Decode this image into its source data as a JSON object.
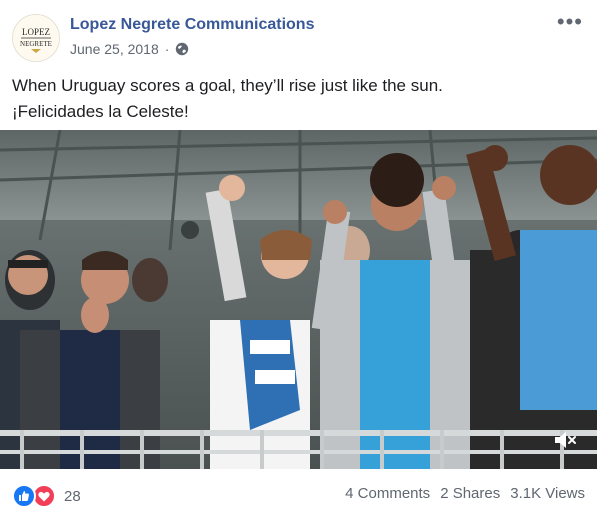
{
  "post": {
    "page_name": "Lopez Negrete Communications",
    "date": "June 25, 2018",
    "separator": "·",
    "privacy_icon": "globe-icon",
    "more_icon": "more-options-icon",
    "avatar_logo_text": "LOPEZ NEGRETE",
    "text_line_1": "When Uruguay scores a goal, they’ll rise just like the sun.",
    "text_line_2": "¡Felicidades la Celeste!"
  },
  "video": {
    "description_icon": "mute-icon"
  },
  "footer": {
    "reaction_icons": [
      "like-icon",
      "love-icon"
    ],
    "reaction_count": "28",
    "comments": "4 Comments",
    "shares": "2 Shares",
    "views": "3.1K Views"
  },
  "colors": {
    "link_blue": "#385898",
    "like_blue": "#1877f2",
    "love_red": "#f33e58",
    "meta_gray": "#606770",
    "text": "#1c1e21"
  }
}
